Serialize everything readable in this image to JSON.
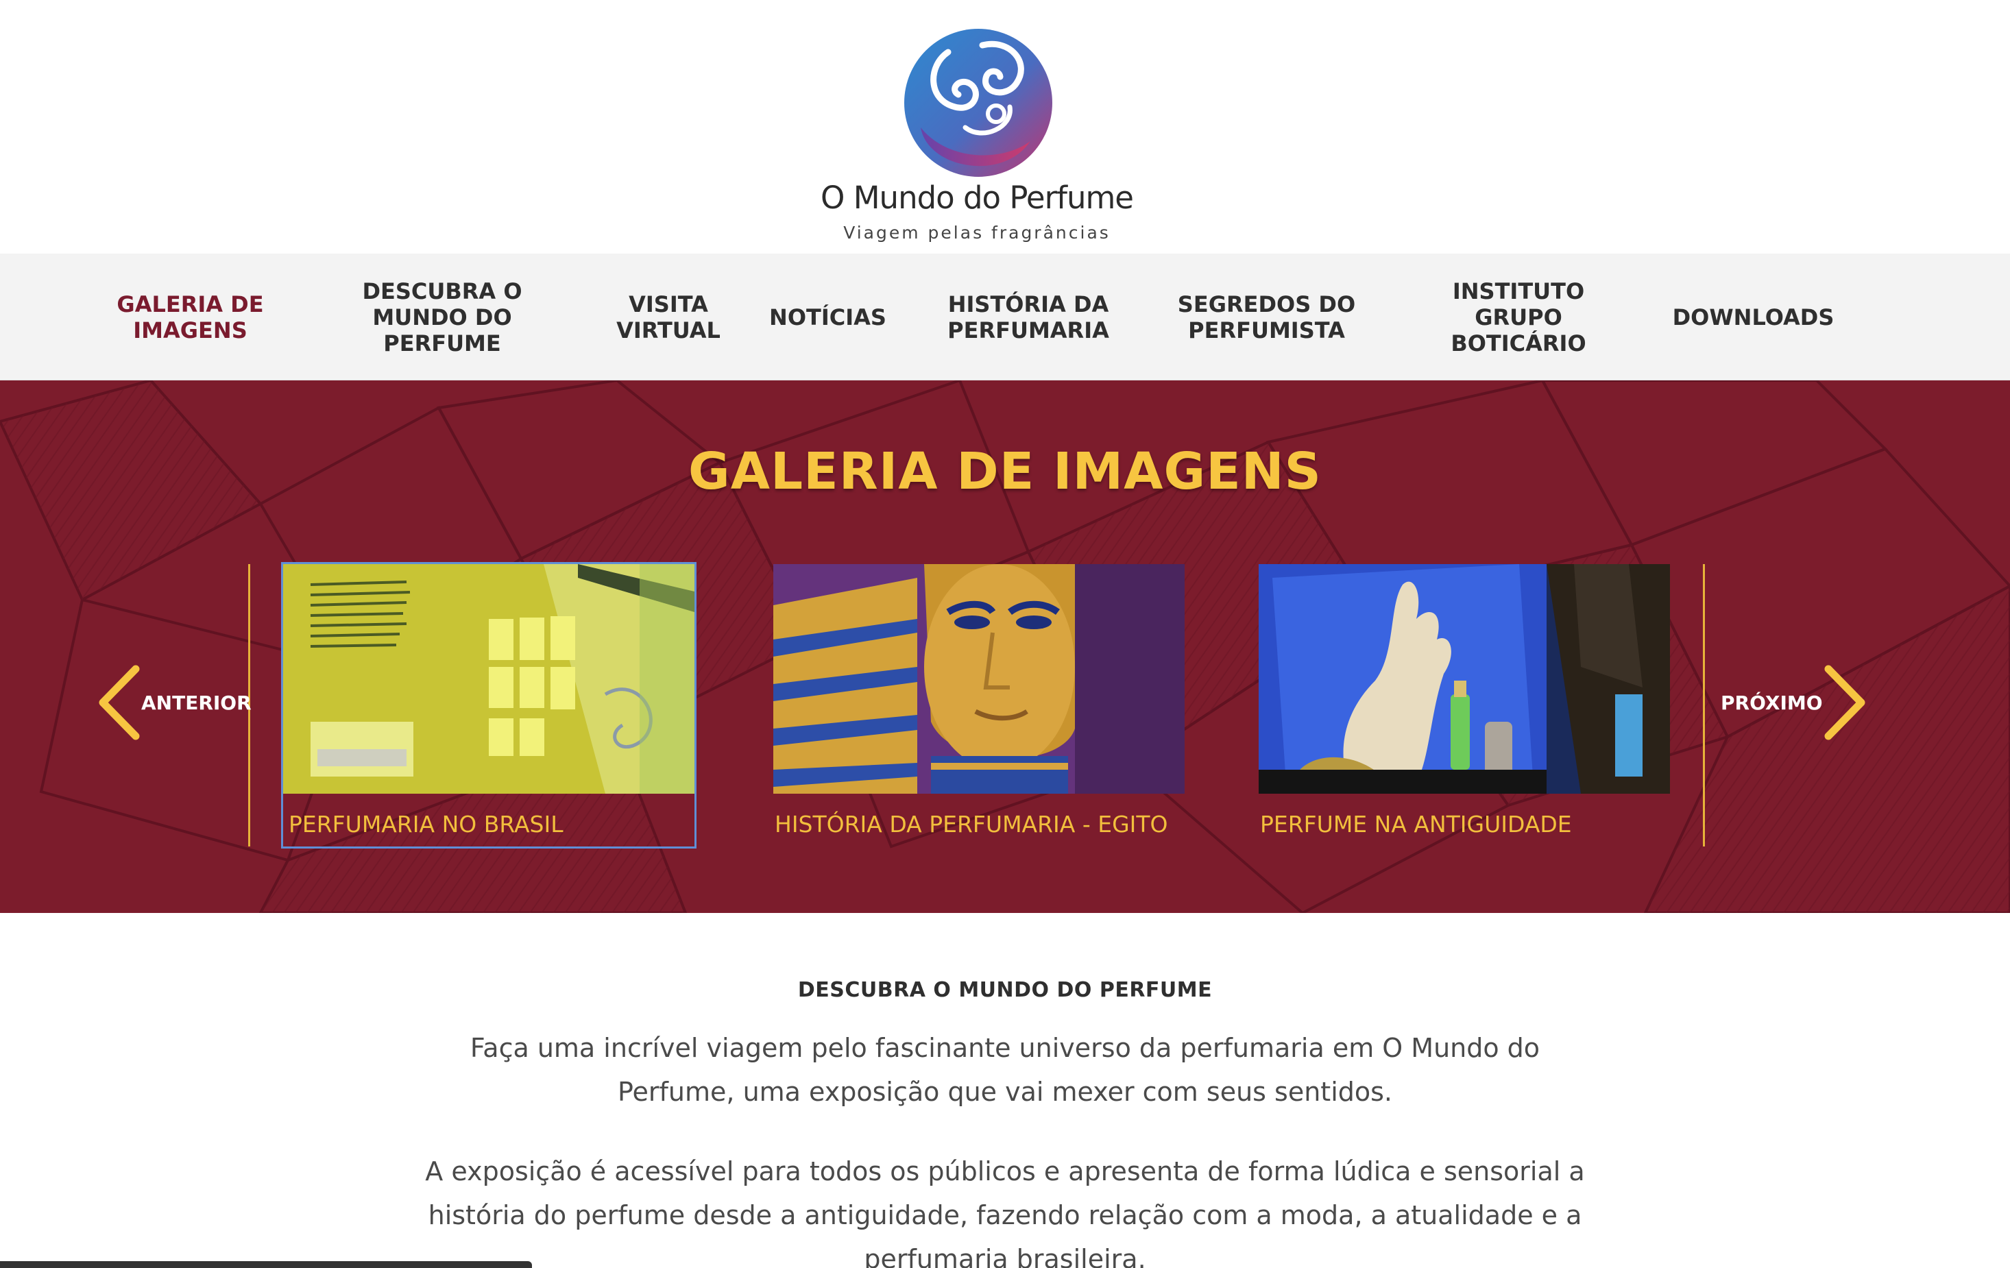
{
  "logo": {
    "title": "O Mundo do Perfume",
    "tagline": "Viagem pelas fragrâncias",
    "brand_colors": [
      "#2e7fc4",
      "#7b3fa0",
      "#c0336f"
    ]
  },
  "nav": {
    "items": [
      {
        "label": "GALERIA DE IMAGENS",
        "active": true
      },
      {
        "label": "DESCUBRA O MUNDO DO PERFUME"
      },
      {
        "label": "VISITA VIRTUAL"
      },
      {
        "label": "NOTÍCIAS"
      },
      {
        "label": "HISTÓRIA DA PERFUMARIA"
      },
      {
        "label": "SEGREDOS DO PERFUMISTA"
      },
      {
        "label": "INSTITUTO GRUPO BOTICÁRIO"
      },
      {
        "label": "DOWNLOADS"
      }
    ],
    "active_color": "#7a1b2e"
  },
  "gallery": {
    "title": "GALERIA DE IMAGENS",
    "prev_label": "ANTERIOR",
    "next_label": "PRÓXIMO",
    "background_color": "#7c1c2c",
    "accent_color": "#f7c541",
    "cards": [
      {
        "caption": "PERFUMARIA NO BRASIL",
        "image": "exhibition-wall-photo"
      },
      {
        "caption": "HISTÓRIA DA PERFUMARIA - EGITO",
        "image": "pharaoh-mask-photo"
      },
      {
        "caption": "PERFUME NA ANTIGUIDADE",
        "image": "display-case-photo"
      }
    ]
  },
  "content": {
    "heading": "DESCUBRA O MUNDO DO PERFUME",
    "paragraph1": "Faça uma incrível viagem pelo fascinante universo da perfumaria em O Mundo do Perfume, uma exposição que vai mexer com seus sentidos.",
    "paragraph2": "A exposição é acessível para todos os públicos e apresenta de forma lúdica e sensorial a história do perfume desde a antiguidade, fazendo relação com a moda, a atualidade e a perfumaria brasileira."
  }
}
